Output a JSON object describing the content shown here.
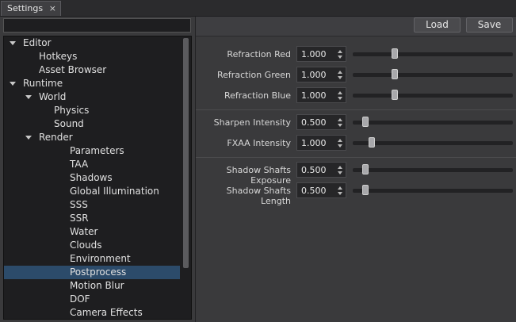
{
  "tab": {
    "label": "Settings",
    "close": "×"
  },
  "search": {
    "value": "",
    "placeholder": ""
  },
  "tree": [
    {
      "label": "Editor",
      "level": 0,
      "expanded": true
    },
    {
      "label": "Hotkeys",
      "level": 2
    },
    {
      "label": "Asset Browser",
      "level": 2
    },
    {
      "label": "Runtime",
      "level": 0,
      "expanded": true
    },
    {
      "label": "World",
      "level": 1,
      "expanded": true
    },
    {
      "label": "Physics",
      "level": 3
    },
    {
      "label": "Sound",
      "level": 3
    },
    {
      "label": "Render",
      "level": 2,
      "expanded": true
    },
    {
      "label": "Parameters",
      "level": 4
    },
    {
      "label": "TAA",
      "level": 4
    },
    {
      "label": "Shadows",
      "level": 4
    },
    {
      "label": "Global Illumination",
      "level": 4
    },
    {
      "label": "SSS",
      "level": 4
    },
    {
      "label": "SSR",
      "level": 4
    },
    {
      "label": "Water",
      "level": 4
    },
    {
      "label": "Clouds",
      "level": 4
    },
    {
      "label": "Environment",
      "level": 4
    },
    {
      "label": "Postprocess",
      "level": 4,
      "selected": true
    },
    {
      "label": "Motion Blur",
      "level": 4
    },
    {
      "label": "DOF",
      "level": 4
    },
    {
      "label": "Camera Effects",
      "level": 4
    }
  ],
  "toolbar": {
    "load_label": "Load",
    "save_label": "Save"
  },
  "properties": [
    {
      "label": "Refraction Red",
      "value": "1.000",
      "slider": 0.26
    },
    {
      "label": "Refraction Green",
      "value": "1.000",
      "slider": 0.26
    },
    {
      "label": "Refraction Blue",
      "value": "1.000",
      "slider": 0.26
    },
    {
      "label": "Sharpen Intensity",
      "value": "0.500",
      "slider": 0.08,
      "separator_before": true
    },
    {
      "label": "FXAA Intensity",
      "value": "1.000",
      "slider": 0.12
    },
    {
      "label": "Shadow Shafts Exposure",
      "value": "0.500",
      "slider": 0.08,
      "separator_before": true
    },
    {
      "label": "Shadow Shafts Length",
      "value": "0.500",
      "slider": 0.08
    }
  ],
  "colors": {
    "selection": "#2c4b6a",
    "background": "#3a3a3c",
    "field": "#1e1e20"
  }
}
